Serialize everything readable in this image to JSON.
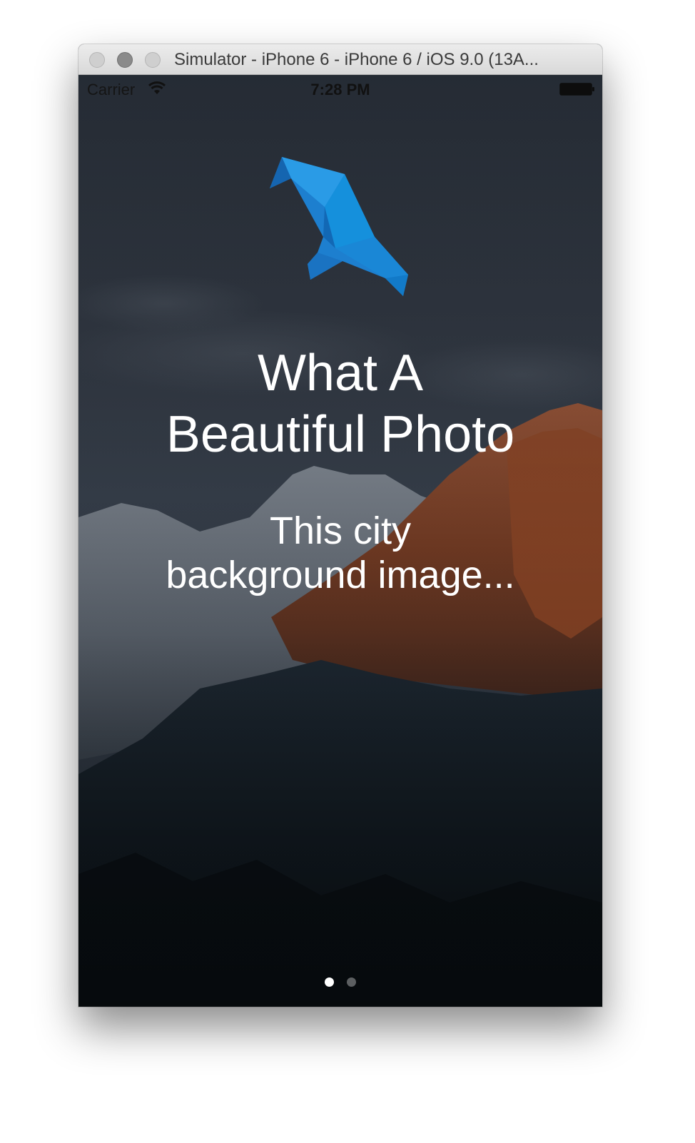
{
  "window": {
    "title": "Simulator - iPhone 6 - iPhone 6 / iOS 9.0 (13A..."
  },
  "status_bar": {
    "carrier": "Carrier",
    "time": "7:28 PM",
    "icons": [
      "wifi-icon",
      "battery-icon"
    ]
  },
  "onboarding": {
    "logo": "bird-logo-icon",
    "headline_line1": "What A",
    "headline_line2": "Beautiful Photo",
    "subtitle_line1": "This city",
    "subtitle_line2": "background image...",
    "page_count": 2,
    "current_page": 1
  },
  "colors": {
    "logo_blue": "#1e8fdc",
    "text": "#ffffff"
  }
}
